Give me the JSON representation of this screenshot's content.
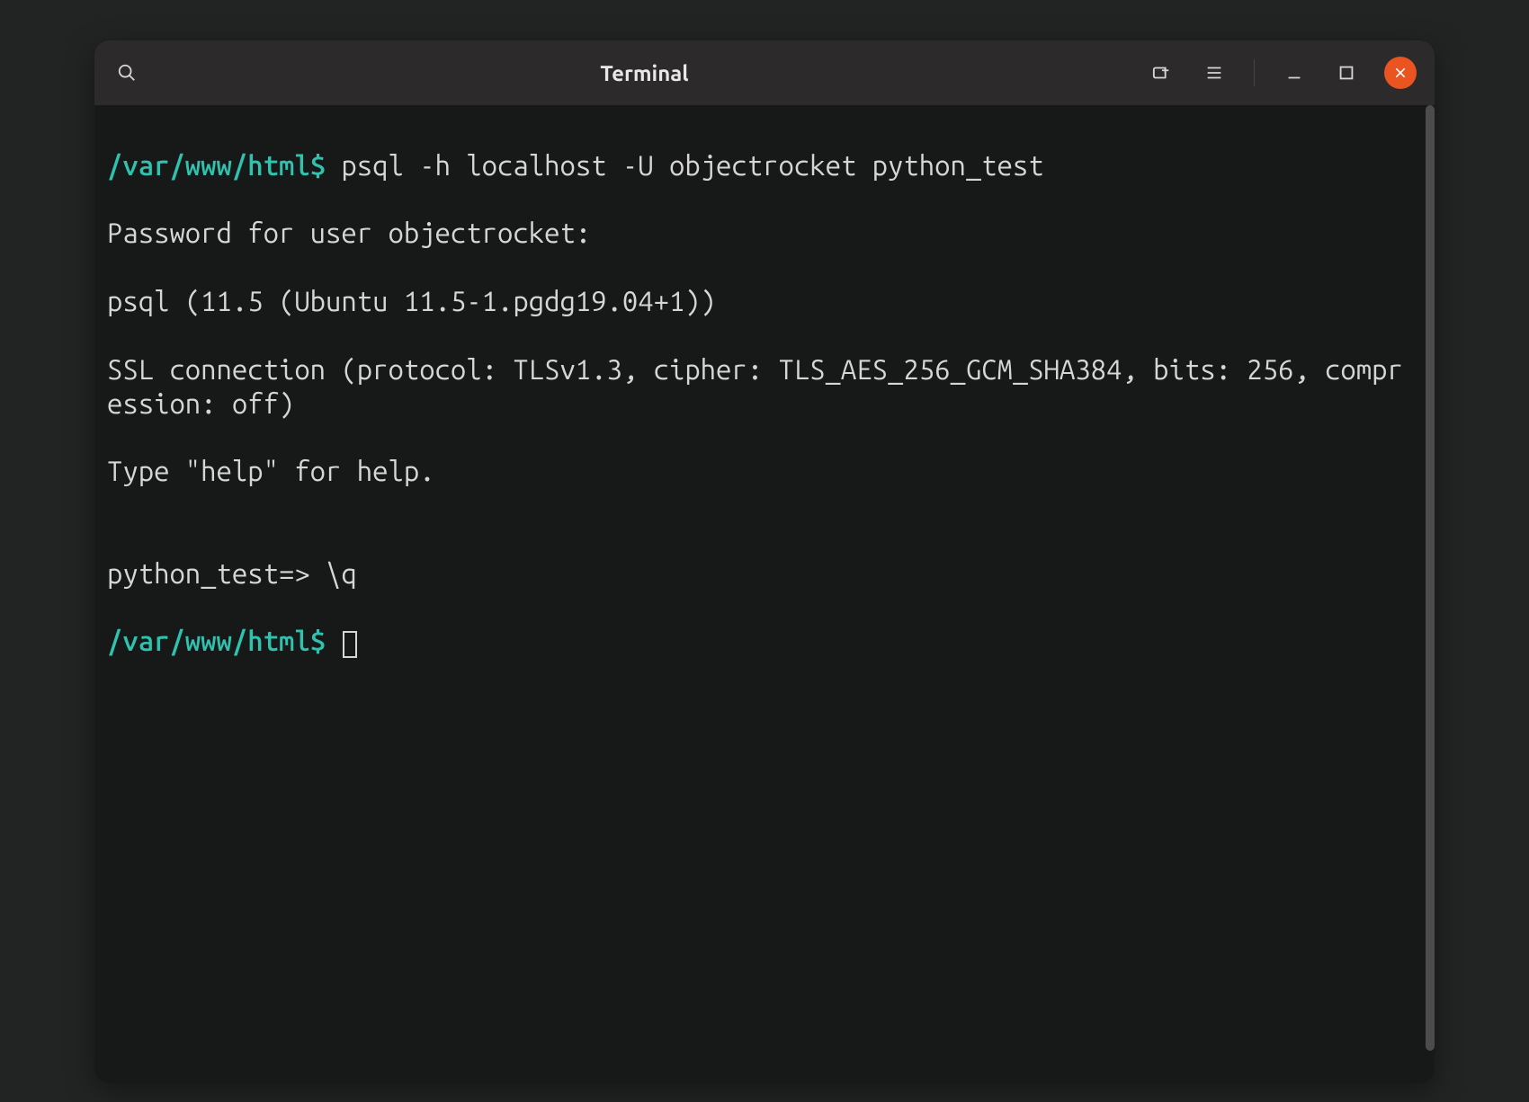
{
  "window": {
    "title": "Terminal"
  },
  "terminal": {
    "line1_prompt_path": "/var/www/html",
    "line1_prompt_dollar": "$",
    "line1_command": " psql -h localhost -U objectrocket python_test",
    "line2": "Password for user objectrocket:",
    "line3": "psql (11.5 (Ubuntu 11.5-1.pgdg19.04+1))",
    "line4": "SSL connection (protocol: TLSv1.3, cipher: TLS_AES_256_GCM_SHA384, bits: 256, compression: off)",
    "line5": "Type \"help\" for help.",
    "line6": "",
    "line7_prompt": "python_test=> ",
    "line7_cmd": "\\q",
    "line8_prompt_path": "/var/www/html",
    "line8_prompt_dollar": "$",
    "line8_command": " "
  }
}
